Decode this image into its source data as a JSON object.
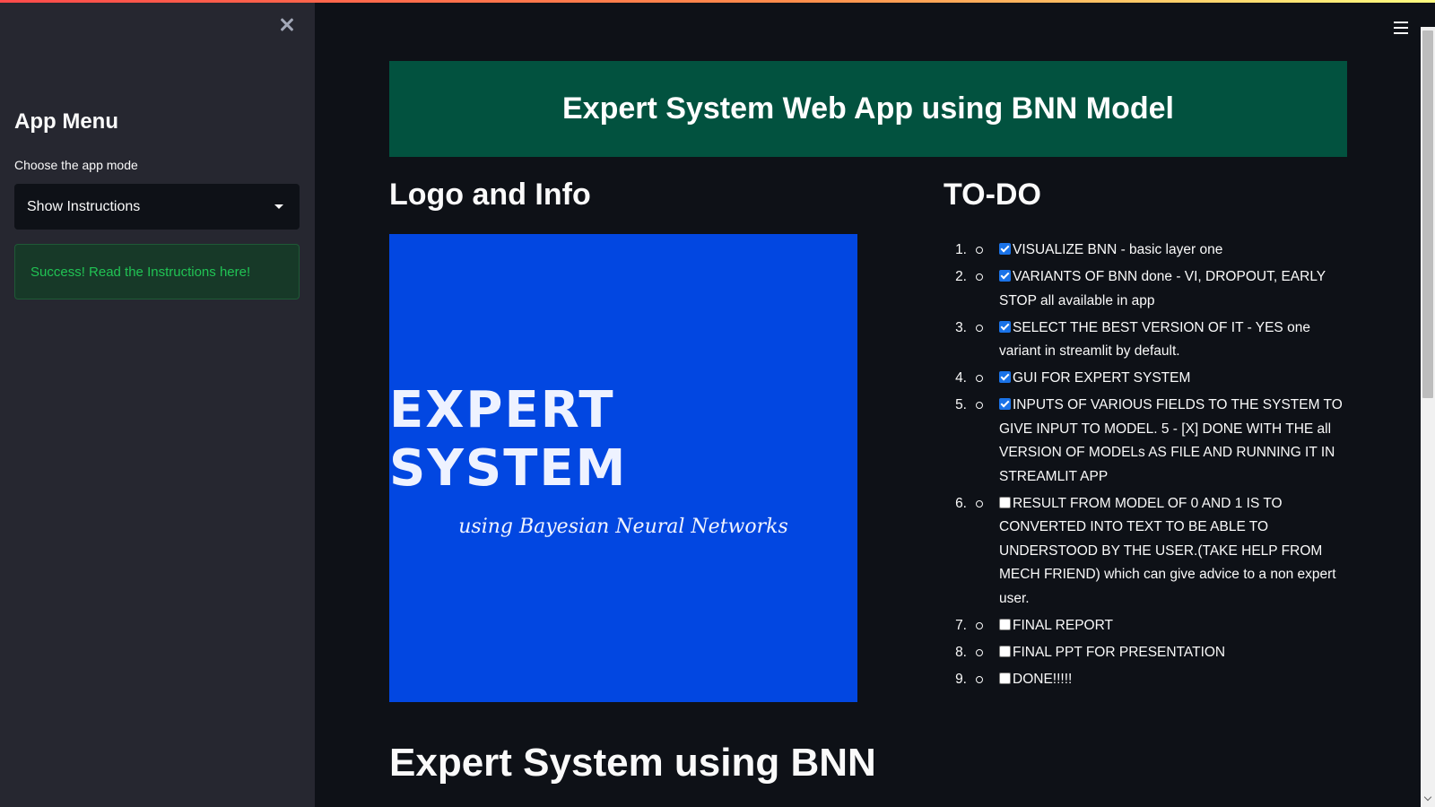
{
  "sidebar": {
    "title": "App Menu",
    "select_label": "Choose the app mode",
    "select_value": "Show Instructions",
    "success_message": "Success! Read the Instructions here!"
  },
  "main": {
    "banner_title": "Expert System Web App using BNN Model",
    "logo_heading": "Logo and Info",
    "todo_heading": "TO-DO",
    "bottom_heading": "Expert System using BNN",
    "logo": {
      "main_text": "EXPERT SYSTEM",
      "sub_text": "using Bayesian Neural Networks"
    },
    "todo": [
      {
        "num": "1.",
        "checked": true,
        "text": "VISUALIZE BNN - basic layer one"
      },
      {
        "num": "2.",
        "checked": true,
        "text": "VARIANTS OF BNN done - VI, DROPOUT, EARLY STOP all available in app"
      },
      {
        "num": "3.",
        "checked": true,
        "text": "SELECT THE BEST VERSION OF IT - YES one variant in streamlit by default."
      },
      {
        "num": "4.",
        "checked": true,
        "text": "GUI FOR EXPERT SYSTEM"
      },
      {
        "num": "5.",
        "checked": true,
        "text": "INPUTS OF VARIOUS FIELDS TO THE SYSTEM TO GIVE INPUT TO MODEL. 5 - [X] DONE WITH THE all VERSION OF MODELs AS FILE AND RUNNING IT IN STREAMLIT APP"
      },
      {
        "num": "6.",
        "checked": false,
        "text": "RESULT FROM MODEL OF 0 AND 1 IS TO CONVERTED INTO TEXT TO BE ABLE TO UNDERSTOOD BY THE USER.(TAKE HELP FROM MECH FRIEND) which can give advice to a non expert user."
      },
      {
        "num": "7.",
        "checked": false,
        "text": "FINAL REPORT"
      },
      {
        "num": "8.",
        "checked": false,
        "text": "FINAL PPT FOR PRESENTATION"
      },
      {
        "num": "9.",
        "checked": false,
        "text": "DONE!!!!!"
      }
    ]
  },
  "colors": {
    "sidebar_bg": "#262730",
    "main_bg": "#0e1117",
    "banner_bg": "#02523f",
    "logo_bg": "#0247e1",
    "success_text": "#21c354",
    "checkbox_checked": "#1a73e8"
  },
  "icons": {
    "close": "close-icon",
    "dropdown": "chevron-down-icon",
    "menu": "hamburger-menu-icon"
  }
}
